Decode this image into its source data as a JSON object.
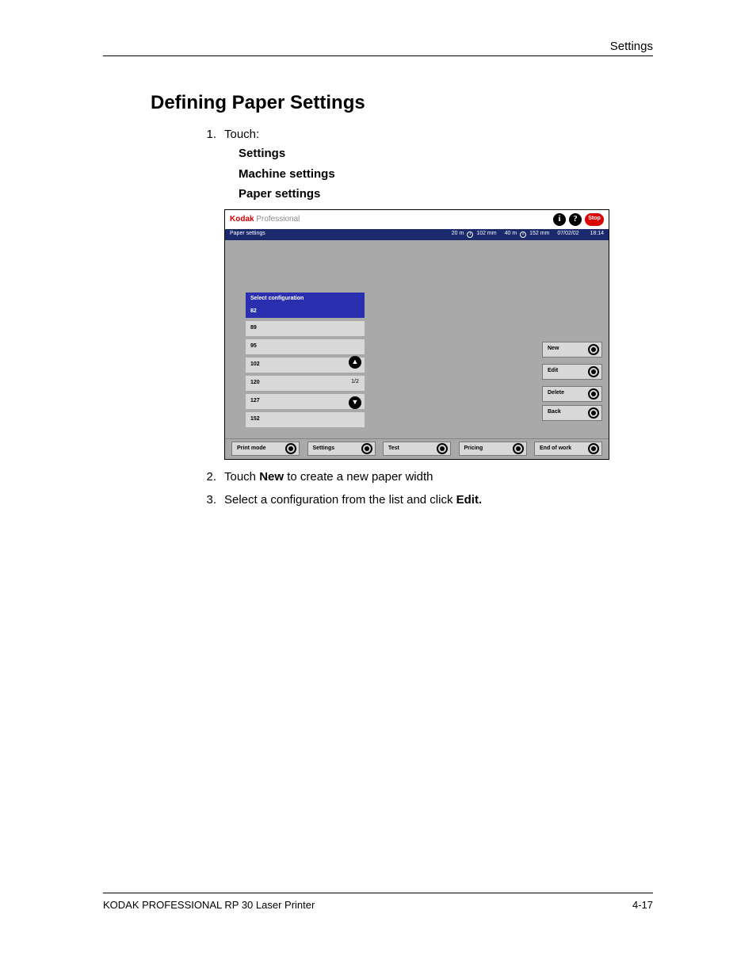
{
  "header": {
    "right": "Settings"
  },
  "title": "Defining Paper Settings",
  "steps": {
    "s1_intro": "Touch:",
    "s1_lines": [
      "Settings",
      "Machine settings",
      "Paper settings"
    ],
    "s2_pre": "Touch ",
    "s2_bold": "New",
    "s2_post": " to create a new paper width",
    "s3_pre": "Select a configuration from the list and click ",
    "s3_bold": "Edit."
  },
  "screenshot": {
    "brand_red": "Kodak",
    "brand_gray": " Professional",
    "stop": "Stop",
    "statusbar": {
      "title": "Paper settings",
      "roll1_len": "20 m",
      "roll1_w": "102 mm",
      "roll2_len": "40 m",
      "roll2_w": "152 mm",
      "date": "07/02/02",
      "time": "18:14"
    },
    "list": {
      "header": "Select configuration",
      "selected": "82",
      "items": [
        "89",
        "95",
        "102",
        "120",
        "127",
        "152"
      ],
      "page_indicator": "1/2"
    },
    "side_buttons": {
      "new": "New",
      "edit": "Edit",
      "delete": "Delete",
      "back": "Back"
    },
    "footer_buttons": {
      "print_mode": "Print mode",
      "settings": "Settings",
      "test": "Test",
      "pricing": "Pricing",
      "end_of_work": "End of work"
    }
  },
  "footer": {
    "left": "KODAK PROFESSIONAL RP 30 Laser Printer",
    "right": "4-17"
  }
}
